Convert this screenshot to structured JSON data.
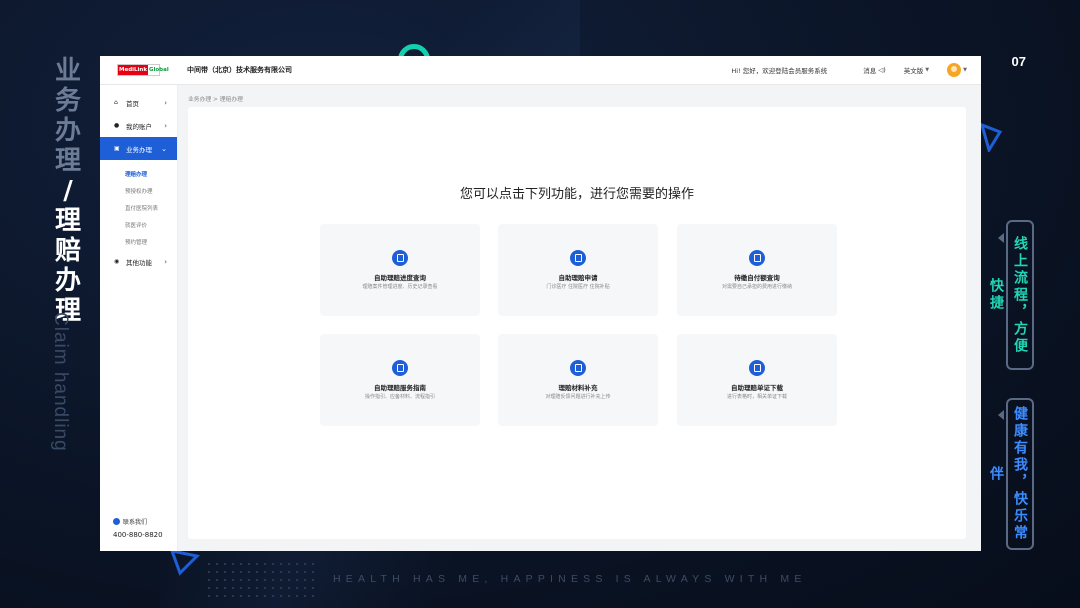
{
  "slide": {
    "number": "07",
    "title_cn": [
      "业",
      "务",
      "办",
      "理",
      "/",
      "理",
      "赔",
      "办",
      "理"
    ],
    "title_en": "Claim handling",
    "tag1": "线上流程，方便快捷",
    "tag2": "健康有我，快乐常伴",
    "footer": "HEALTH HAS ME, HAPPINESS IS ALWAYS WITH ME"
  },
  "colors": {
    "accent": "#1e5fd8",
    "teal": "#21d5b5",
    "bg": "#0b1527"
  },
  "header": {
    "logo_part1": "MediLink",
    "logo_part2": "Global",
    "company": "中间带（北京）技术服务有限公司",
    "welcome": "Hi! 您好，欢迎登陆会员服务系统",
    "messages": "消息",
    "language": "英文版",
    "avatar_icon": "user-avatar"
  },
  "sidebar": {
    "items": [
      {
        "label": "首页",
        "icon": "home-icon"
      },
      {
        "label": "我的账户",
        "icon": "user-icon"
      },
      {
        "label": "业务办理",
        "icon": "briefcase-icon"
      },
      {
        "label": "其他功能",
        "icon": "more-icon"
      }
    ],
    "sub_items": [
      "理赔办理",
      "预授权办理",
      "直付医院列表",
      "就医评价",
      "预约管理"
    ],
    "contact_label": "联系我们",
    "contact_phone": "400-880-8820"
  },
  "main": {
    "breadcrumb": "业务办理 > 理赔办理",
    "headline": "您可以点击下列功能，进行您需要的操作",
    "cards": [
      {
        "title": "自助理赔进度查询",
        "desc": "理赔案件管理进度、历史记录查看"
      },
      {
        "title": "自助理赔申请",
        "desc": "门诊医疗 住院医疗 住院补贴"
      },
      {
        "title": "待缴自付额查询",
        "desc": "对需要自己承担的费用进行缴纳"
      },
      {
        "title": "自助理赔服务指南",
        "desc": "操作指引、应备材料、流程指引"
      },
      {
        "title": "理赔材料补充",
        "desc": "对理赔反馈问题进行补充上传"
      },
      {
        "title": "自助理赔单证下载",
        "desc": "进行表格时，相关单证下载"
      }
    ]
  }
}
